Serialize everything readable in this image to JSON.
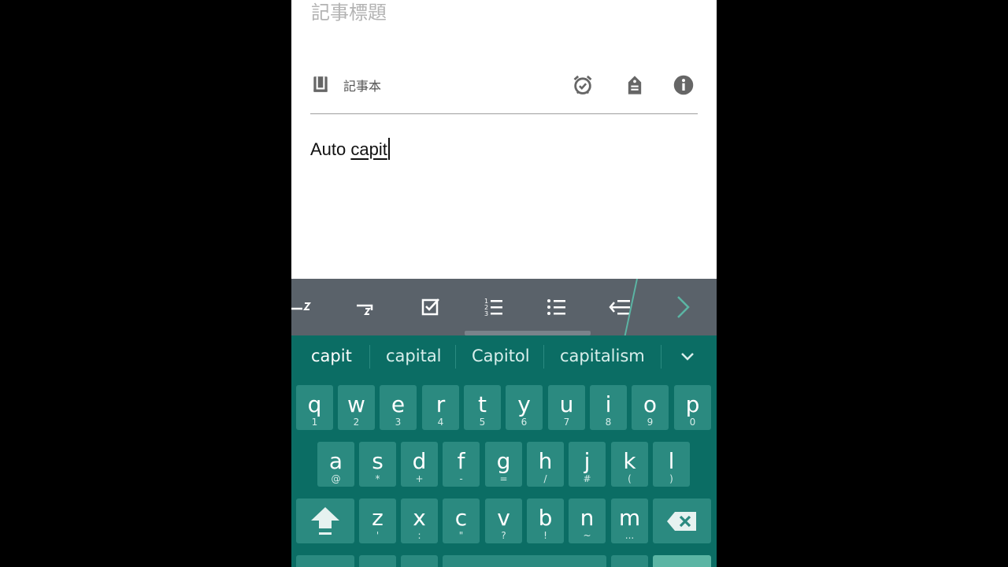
{
  "note": {
    "title_placeholder": "記事標題",
    "notebook_label": "記事本",
    "body_prefix": "Auto ",
    "body_composing": "capit"
  },
  "icons": {
    "notebook": "notebook-icon",
    "reminder": "alarm-check-icon",
    "tag": "tag-icon",
    "info": "info-icon"
  },
  "format_toolbar": [
    "indent-icon",
    "outdent-icon",
    "checkbox-icon",
    "numbered-list-icon",
    "bulleted-list-icon",
    "decrease-indent-icon",
    "chevron-right-icon"
  ],
  "suggestions": [
    "capit",
    "capital",
    "Capitol",
    "capitalism"
  ],
  "keyboard": {
    "row1": [
      {
        "main": "q",
        "sub": "1"
      },
      {
        "main": "w",
        "sub": "2"
      },
      {
        "main": "e",
        "sub": "3"
      },
      {
        "main": "r",
        "sub": "4"
      },
      {
        "main": "t",
        "sub": "5"
      },
      {
        "main": "y",
        "sub": "6"
      },
      {
        "main": "u",
        "sub": "7"
      },
      {
        "main": "i",
        "sub": "8"
      },
      {
        "main": "o",
        "sub": "9"
      },
      {
        "main": "p",
        "sub": "0"
      }
    ],
    "row2": [
      {
        "main": "a",
        "sub": "@"
      },
      {
        "main": "s",
        "sub": "*"
      },
      {
        "main": "d",
        "sub": "+"
      },
      {
        "main": "f",
        "sub": "-"
      },
      {
        "main": "g",
        "sub": "="
      },
      {
        "main": "h",
        "sub": "/"
      },
      {
        "main": "j",
        "sub": "#"
      },
      {
        "main": "k",
        "sub": "("
      },
      {
        "main": "l",
        "sub": ")"
      }
    ],
    "row3": [
      {
        "main": "z",
        "sub": "'"
      },
      {
        "main": "x",
        "sub": ":"
      },
      {
        "main": "c",
        "sub": "\""
      },
      {
        "main": "v",
        "sub": "?"
      },
      {
        "main": "b",
        "sub": "!"
      },
      {
        "main": "n",
        "sub": "~"
      },
      {
        "main": "m",
        "sub": "..."
      }
    ]
  },
  "colors": {
    "keyboard_bg": "#0b6d64",
    "key_bg": "#2b8a80",
    "toolbar_bg": "#5a626a",
    "accent": "#5bb5a4"
  }
}
